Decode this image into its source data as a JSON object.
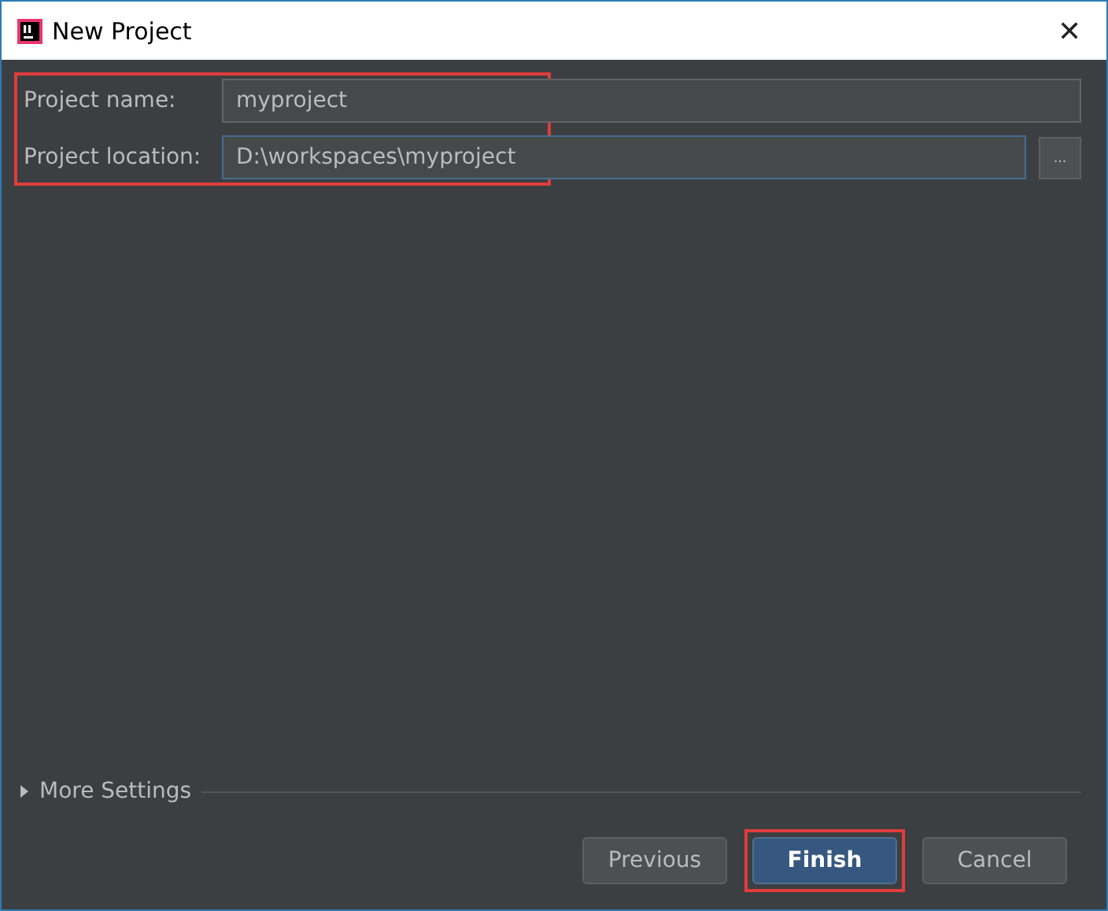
{
  "window": {
    "title": "New Project",
    "close": "✕"
  },
  "fields": {
    "highlighted": true,
    "items": [
      {
        "label": "Project name:",
        "value": "myproject",
        "focused": false
      },
      {
        "label": "Project location:",
        "value": "D:\\workspaces\\myproject",
        "focused": true,
        "browse": "..."
      }
    ]
  },
  "more_settings": {
    "label": "More Settings",
    "expanded": false
  },
  "buttons": [
    {
      "label": "Previous",
      "kind": "normal",
      "highlighted": false
    },
    {
      "label": "Finish",
      "kind": "default",
      "highlighted": true
    },
    {
      "label": "Cancel",
      "kind": "normal",
      "highlighted": false
    }
  ]
}
